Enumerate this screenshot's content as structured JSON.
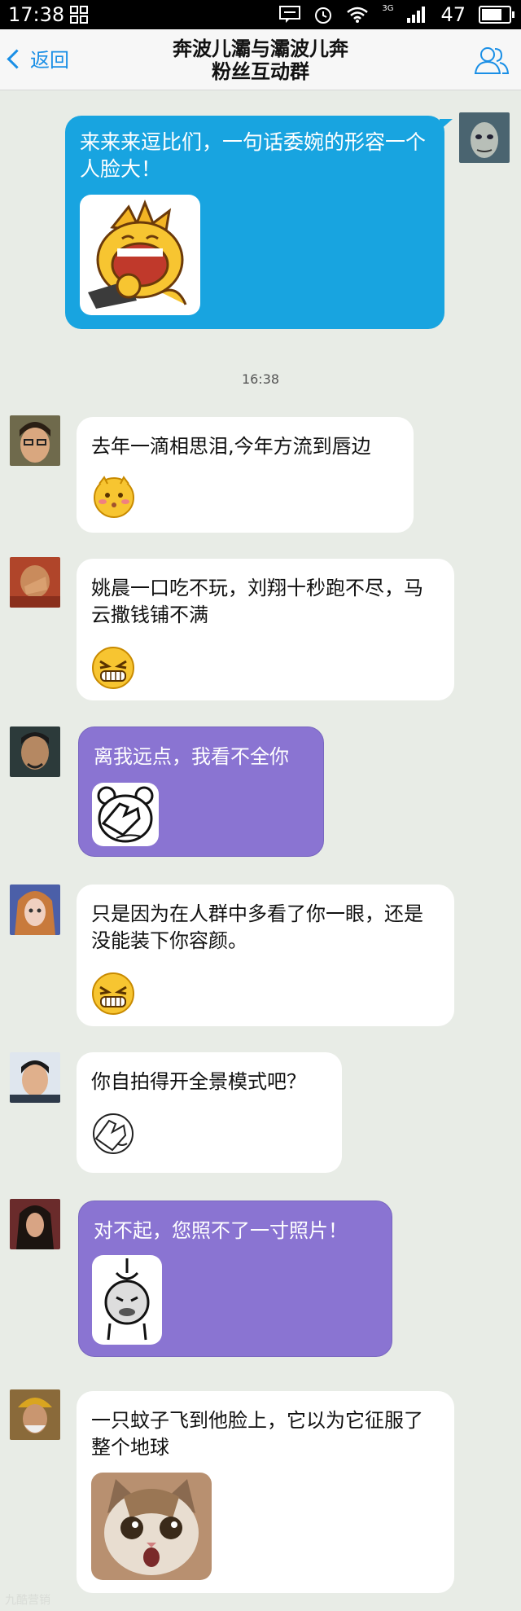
{
  "status_bar": {
    "time": "17:38",
    "battery": "47",
    "network": "3G"
  },
  "header": {
    "back_label": "返回",
    "title_line1": "奔波儿灞与灞波儿奔",
    "title_line2": "粉丝互动群"
  },
  "sent_message": {
    "text": "来来来逗比们，一句话委婉的形容一个人脸大！"
  },
  "timestamp": "16:38",
  "messages": [
    {
      "text": "去年一滴相思泪,今年方流到唇边",
      "style": "white"
    },
    {
      "text": "姚晨一口吃不玩，刘翔十秒跑不尽，马云撒钱铺不满",
      "style": "white"
    },
    {
      "text": "离我远点，我看不全你",
      "style": "purple"
    },
    {
      "text": "只是因为在人群中多看了你一眼，还是没能装下你容颜。",
      "style": "white"
    },
    {
      "text": "你自拍得开全景模式吧？",
      "style": "white"
    },
    {
      "text": "对不起，您照不了一寸照片！",
      "style": "purple"
    },
    {
      "text": "一只蚊子飞到他脸上，它以为它征服了整个地球",
      "style": "white"
    }
  ],
  "watermark": "九酷营销",
  "colors": {
    "sent_bubble": "#18a4e0",
    "purple_bubble": "#8a74d2",
    "link": "#1a8fe6"
  }
}
